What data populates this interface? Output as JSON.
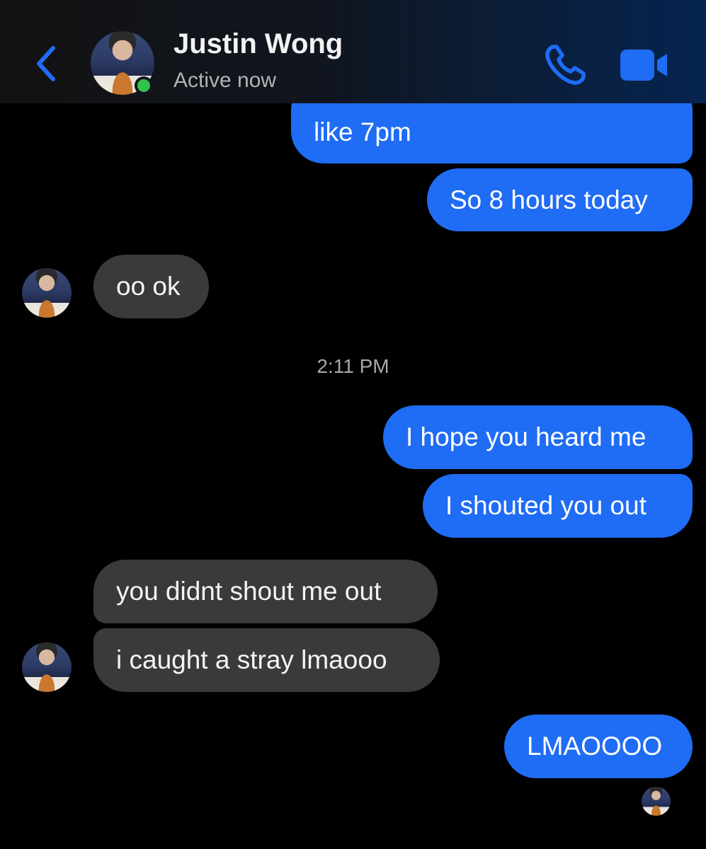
{
  "header": {
    "contact_name": "Justin Wong",
    "contact_status": "Active now",
    "icons": {
      "back": "chevron-left-icon",
      "call": "phone-icon",
      "video": "video-camera-icon"
    },
    "accent": "#1f6cf5",
    "online_color": "#31c24a"
  },
  "messages": [
    {
      "direction": "sent",
      "text": "like 7pm",
      "partially_hidden": true
    },
    {
      "direction": "sent",
      "text": "So 8 hours today"
    },
    {
      "direction": "received",
      "text": "oo ok"
    },
    {
      "direction": "timestamp",
      "text": "2:11 PM"
    },
    {
      "direction": "sent",
      "text": "I hope you heard me"
    },
    {
      "direction": "sent",
      "text": "I shouted you out"
    },
    {
      "direction": "received",
      "text": "you didnt shout me out"
    },
    {
      "direction": "received",
      "text": "i caught a stray lmaooo"
    },
    {
      "direction": "sent",
      "text": "LMAOOOO"
    }
  ],
  "colors": {
    "sent_bubble": "#1f6cf5",
    "received_bubble": "#3a3a3c",
    "background": "#000000"
  }
}
